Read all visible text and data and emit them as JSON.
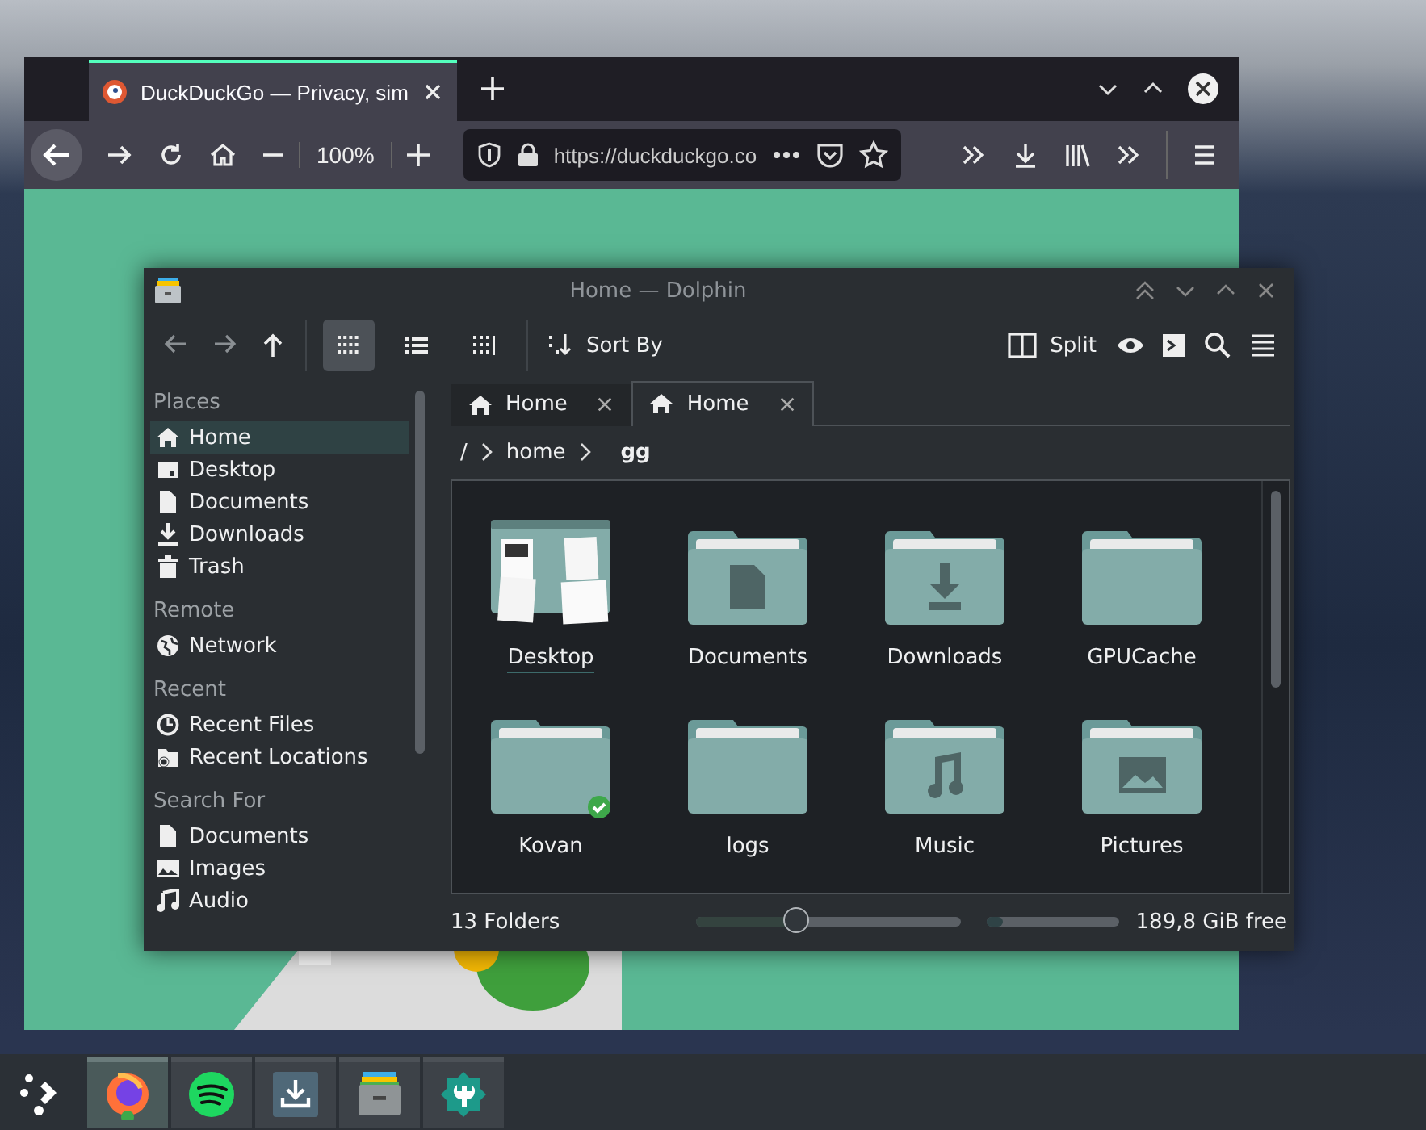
{
  "browser": {
    "tabs": [
      {
        "title": "DuckDuckGo — Privacy, sim",
        "selected": true
      }
    ],
    "zoom": "100%",
    "url": "https://duckduckgo.co"
  },
  "dolphin": {
    "title": "Home — Dolphin",
    "view_modes": [
      {
        "kind": "icons",
        "selected": true
      },
      {
        "kind": "details",
        "selected": false
      },
      {
        "kind": "compact",
        "selected": false
      }
    ],
    "sort_label": "Sort By",
    "split_label": "Split",
    "tabs": [
      {
        "label": "Home",
        "selected": false
      },
      {
        "label": "Home",
        "selected": true
      }
    ],
    "breadcrumb": [
      "/",
      "home",
      "gg"
    ],
    "sidebar": [
      {
        "heading": "Places",
        "items": [
          {
            "label": "Home",
            "kind": "home",
            "selected": true
          },
          {
            "label": "Desktop",
            "kind": "desktop",
            "selected": false
          },
          {
            "label": "Documents",
            "kind": "document",
            "selected": false
          },
          {
            "label": "Downloads",
            "kind": "download",
            "selected": false
          },
          {
            "label": "Trash",
            "kind": "trash",
            "selected": false
          }
        ]
      },
      {
        "heading": "Remote",
        "items": [
          {
            "label": "Network",
            "kind": "globe",
            "selected": false
          }
        ]
      },
      {
        "heading": "Recent",
        "items": [
          {
            "label": "Recent Files",
            "kind": "clock",
            "selected": false
          },
          {
            "label": "Recent Locations",
            "kind": "folderclock",
            "selected": false
          }
        ]
      },
      {
        "heading": "Search For",
        "items": [
          {
            "label": "Documents",
            "kind": "document",
            "selected": false
          },
          {
            "label": "Images",
            "kind": "image",
            "selected": false
          },
          {
            "label": "Audio",
            "kind": "music",
            "selected": false
          }
        ]
      }
    ],
    "files": [
      {
        "name": "Desktop",
        "kind": "desktop",
        "synced": false
      },
      {
        "name": "Documents",
        "kind": "documents",
        "synced": false
      },
      {
        "name": "Downloads",
        "kind": "downloads",
        "synced": false
      },
      {
        "name": "GPUCache",
        "kind": "plain",
        "synced": false
      },
      {
        "name": "Kovan",
        "kind": "plain",
        "synced": true
      },
      {
        "name": "logs",
        "kind": "plain",
        "synced": false
      },
      {
        "name": "Music",
        "kind": "music",
        "synced": false
      },
      {
        "name": "Pictures",
        "kind": "pictures",
        "synced": false
      }
    ],
    "status": {
      "count": "13 Folders",
      "zoom": {
        "level": 0.38
      },
      "space": {
        "level": 0.12
      },
      "free": "189,8 GiB free"
    }
  },
  "taskbar": [
    {
      "kind": "launcher"
    },
    {
      "kind": "firefox",
      "active": true
    },
    {
      "kind": "spotify",
      "active": false
    },
    {
      "kind": "downloader",
      "active": false
    },
    {
      "kind": "files",
      "active": false
    },
    {
      "kind": "settings",
      "active": false
    }
  ]
}
